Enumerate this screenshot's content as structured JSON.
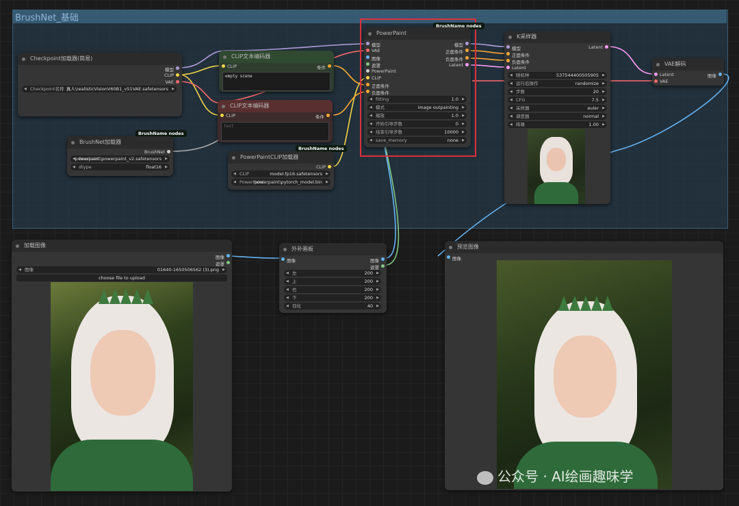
{
  "group": {
    "title": "BrushNet_基础"
  },
  "badge": "BrushName nodes",
  "checkpoint": {
    "title": "Checkpoint加载器(简易)",
    "outputs": [
      "模型",
      "CLIP",
      "VAE"
    ],
    "widget_label": "Checkpoint名称",
    "widget_value": "真人\\realisticVisionV60B1_v51VAE.safetensors"
  },
  "clip_pos": {
    "title": "CLIP文本编码器",
    "input": "CLIP",
    "output": "条件",
    "text": "empty scene"
  },
  "clip_neg": {
    "title": "CLIP文本编码器",
    "input": "CLIP",
    "output": "条件",
    "placeholder": "text"
  },
  "brushnet": {
    "title": "BrushNet加载器",
    "output": "BrushNet",
    "widgets": [
      {
        "label": "Brushnet",
        "value": "powerpaint\\powerpaint_v2.safetensors"
      },
      {
        "label": "dtype",
        "value": "float16"
      }
    ]
  },
  "ppclip": {
    "title": "PowerPaintCLIP加载器",
    "output": "CLIP",
    "widgets": [
      {
        "label": "CLIP",
        "value": "model.fp16.safetensors"
      },
      {
        "label": "PowerPaint",
        "value": "powerpaint\\pytorch_model.bin"
      }
    ]
  },
  "powerpaint": {
    "title": "PowerPaint",
    "inputs": [
      "模型",
      "VAE",
      "图像",
      "遮罩",
      "PowerPaint",
      "CLIP",
      "正面条件",
      "负面条件"
    ],
    "outputs": [
      "模型",
      "正面条件",
      "负面条件",
      "Latent"
    ],
    "widgets": [
      {
        "label": "fitting",
        "value": "1.0"
      },
      {
        "label": "模式",
        "value": "image outpainting"
      },
      {
        "label": "缩放",
        "value": "1.0"
      },
      {
        "label": "开始引导步数",
        "value": "0"
      },
      {
        "label": "结束引导步数",
        "value": "10000"
      },
      {
        "label": "save_memory",
        "value": "none"
      }
    ]
  },
  "ksampler": {
    "title": "K采样器",
    "inputs": [
      "模型",
      "正面条件",
      "负面条件",
      "Latent"
    ],
    "output": "Latent",
    "widgets": [
      {
        "label": "随机种",
        "value": "537544400505905"
      },
      {
        "label": "运行后操作",
        "value": "randomize"
      },
      {
        "label": "步数",
        "value": "20"
      },
      {
        "label": "CFG",
        "value": "7.5"
      },
      {
        "label": "采样器",
        "value": "euler"
      },
      {
        "label": "调度器",
        "value": "normal"
      },
      {
        "label": "降噪",
        "value": "1.00"
      }
    ]
  },
  "vae_decode": {
    "title": "VAE解码",
    "inputs": [
      "Latent",
      "VAE"
    ],
    "output": "图像"
  },
  "load_image": {
    "title": "加载图像",
    "outputs": [
      "图像",
      "遮罩"
    ],
    "widget_label": "图像",
    "widget_value": "01640-1650506562 (3).png",
    "upload_label": "choose file to upload"
  },
  "pad": {
    "title": "外补画板",
    "input": "图像",
    "outputs": [
      "图像",
      "遮罩"
    ],
    "widgets": [
      {
        "label": "左",
        "value": "200"
      },
      {
        "label": "上",
        "value": "200"
      },
      {
        "label": "右",
        "value": "200"
      },
      {
        "label": "下",
        "value": "200"
      },
      {
        "label": "羽化",
        "value": "40"
      }
    ]
  },
  "preview": {
    "title": "预览图像",
    "input": "图像"
  },
  "watermark": "公众号 · AI绘画趣味学",
  "colors": {
    "model": "#b39ddb",
    "clip": "#f5d547",
    "vae": "#ff6b6b",
    "cond": "#ffa931",
    "latent": "#ff9cf9",
    "image": "#64b5f6",
    "mask": "#81c784",
    "highlight": "#e0303a"
  }
}
